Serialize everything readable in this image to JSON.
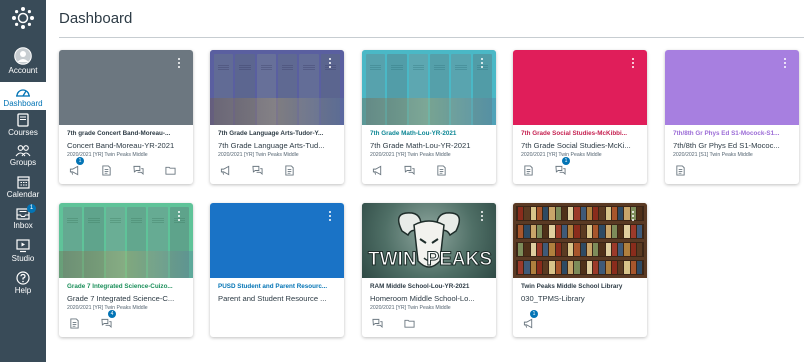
{
  "app": {
    "page_title": "Dashboard"
  },
  "nav": {
    "items": [
      {
        "label": "Account",
        "icon": "avatar-icon"
      },
      {
        "label": "Dashboard",
        "icon": "dashboard-icon"
      },
      {
        "label": "Courses",
        "icon": "book-icon"
      },
      {
        "label": "Groups",
        "icon": "groups-icon"
      },
      {
        "label": "Calendar",
        "icon": "calendar-icon"
      },
      {
        "label": "Inbox",
        "icon": "inbox-icon",
        "badge": "1"
      },
      {
        "label": "Studio",
        "icon": "studio-icon"
      },
      {
        "label": "Help",
        "icon": "help-icon"
      }
    ]
  },
  "colors": {
    "nav_bg": "#394b58",
    "accent": "#0374b5"
  },
  "cards": [
    {
      "name": "7th grade Concert Band-Moreau-...",
      "code": "Concert Band-Moreau-YR-2021",
      "term": "2020/2021 [YR] Twin Peaks Middle",
      "name_color": "#2d3b45",
      "hero_color": "#6c7780",
      "art": "plain",
      "icons": [
        {
          "icon": "announcement-icon",
          "badge": "1"
        },
        {
          "icon": "assignment-icon"
        },
        {
          "icon": "discussion-icon"
        },
        {
          "icon": "folder-icon"
        }
      ]
    },
    {
      "name": "7th Grade Language Arts-Tudor-Y...",
      "code": "7th Grade Language Arts-Tud...",
      "term": "2020/2021 [YR] Twin Peaks Middle",
      "name_color": "#2d3b45",
      "hero_color": "#5b5fa0",
      "art": "lockers",
      "icons": [
        {
          "icon": "announcement-icon"
        },
        {
          "icon": "discussion-icon"
        },
        {
          "icon": "assignment-icon"
        }
      ]
    },
    {
      "name": "7th Grade Math-Lou-YR-2021",
      "code": "7th Grade Math-Lou-YR-2021",
      "term": "2020/2021 [YR] Twin Peaks Middle",
      "name_color": "#0b8694",
      "hero_color": "#4ab8c6",
      "art": "lockers",
      "icons": [
        {
          "icon": "announcement-icon"
        },
        {
          "icon": "discussion-icon"
        },
        {
          "icon": "assignment-icon"
        }
      ]
    },
    {
      "name": "7th Grade Social Studies-McKibbi...",
      "code": "7th Grade Social Studies-McKi...",
      "term": "2020/2021 [YR] Twin Peaks Middle",
      "name_color": "#c51f4f",
      "hero_color": "#e01e5a",
      "art": "plain",
      "icons": [
        {
          "icon": "assignment-icon"
        },
        {
          "icon": "discussion-icon",
          "badge": "1"
        }
      ]
    },
    {
      "name": "7th/8th Gr Phys Ed S1-Mocock-S1...",
      "code": "7th/8th Gr Phys Ed S1-Mococ...",
      "term": "2020/2021 [S1] Twin Peaks Middle",
      "name_color": "#9b6bd6",
      "hero_color": "#a77fe0",
      "art": "plain",
      "icons": [
        {
          "icon": "assignment-icon"
        }
      ]
    },
    {
      "name": "Grade 7 Integrated Science-Cuizo...",
      "code": "Grade 7 Integrated Science-C...",
      "term": "2020/2021 [YR] Twin Peaks Middle",
      "name_color": "#1b8f5a",
      "hero_color": "#5fc39a",
      "art": "lockers",
      "icons": [
        {
          "icon": "assignment-icon"
        },
        {
          "icon": "discussion-icon",
          "badge": "4"
        }
      ]
    },
    {
      "name": "PUSD Student and Parent Resourc...",
      "code": "Parent and Student Resource ...",
      "term": "",
      "name_color": "#0374b5",
      "hero_color": "#1a73c6",
      "art": "plain",
      "icons": []
    },
    {
      "name": "RAM Middle School-Lou-YR-2021",
      "code": "Homeroom Middle School-Lo...",
      "term": "2020/2021 [YR] Twin Peaks Middle",
      "name_color": "#2d3b45",
      "hero_color": "#4a6e64",
      "art": "twinpeaks",
      "hero_text_left": "TWIN",
      "hero_text_right": "PEAKS",
      "icons": [
        {
          "icon": "discussion-icon"
        },
        {
          "icon": "folder-icon"
        }
      ]
    },
    {
      "name": "Twin Peaks Middle School Library",
      "code": "030_TPMS-Library",
      "term": "",
      "name_color": "#2d3b45",
      "hero_color": "#6b4a30",
      "art": "shelves",
      "icons": [
        {
          "icon": "announcement-icon",
          "badge": "1"
        }
      ]
    }
  ]
}
